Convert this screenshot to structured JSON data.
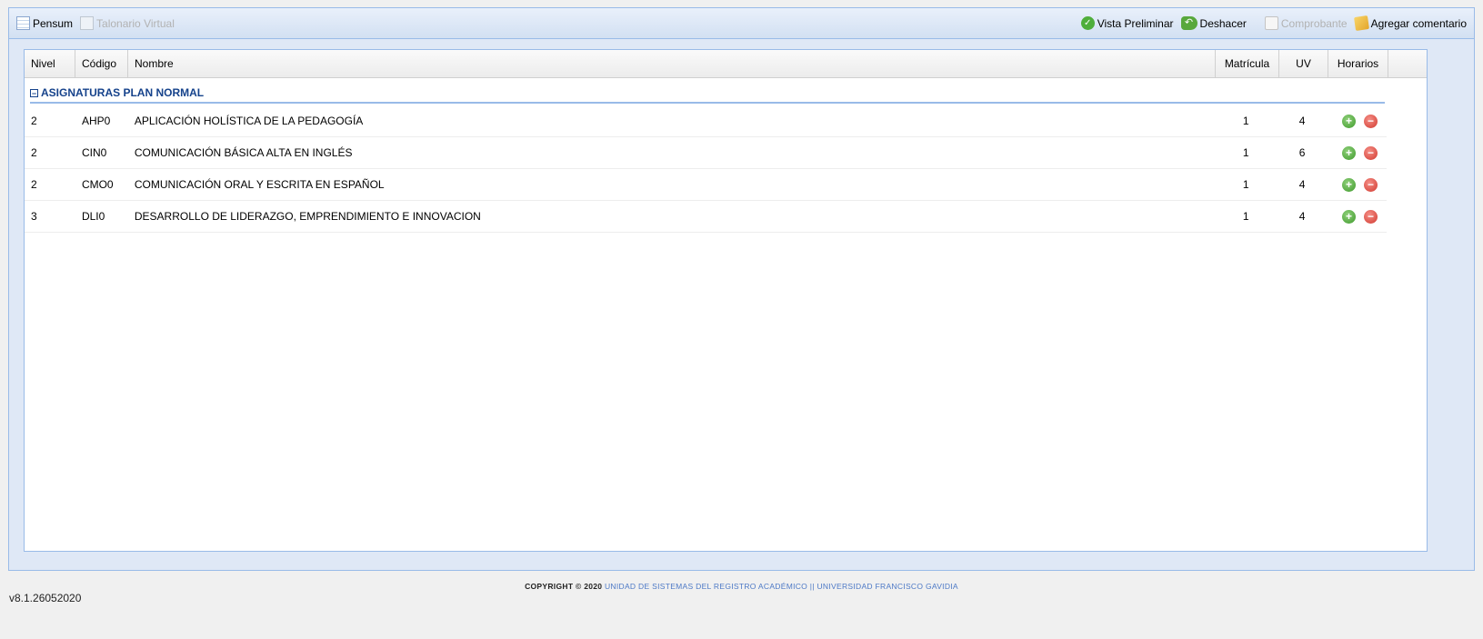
{
  "toolbar": {
    "pensum": "Pensum",
    "talonario": "Talonario Virtual",
    "vista": "Vista Preliminar",
    "deshacer": "Deshacer",
    "comprobante": "Comprobante",
    "agregar": "Agregar comentario"
  },
  "grid": {
    "columns": {
      "nivel": "Nivel",
      "codigo": "Código",
      "nombre": "Nombre",
      "matricula": "Matrícula",
      "uv": "UV",
      "horarios": "Horarios"
    },
    "group": "ASIGNATURAS PLAN NORMAL",
    "group_toggle": "−",
    "add_glyph": "+",
    "remove_glyph": "−",
    "rows": [
      {
        "nivel": "2",
        "codigo": "AHP0",
        "nombre": "APLICACIÓN HOLÍSTICA DE LA PEDAGOGÍA",
        "matricula": "1",
        "uv": "4"
      },
      {
        "nivel": "2",
        "codigo": "CIN0",
        "nombre": "COMUNICACIÓN BÁSICA ALTA EN INGLÉS",
        "matricula": "1",
        "uv": "6"
      },
      {
        "nivel": "2",
        "codigo": "CMO0",
        "nombre": "COMUNICACIÓN ORAL Y ESCRITA EN ESPAÑOL",
        "matricula": "1",
        "uv": "4"
      },
      {
        "nivel": "3",
        "codigo": "DLI0",
        "nombre": "DESARROLLO DE LIDERAZGO, EMPRENDIMIENTO E INNOVACION",
        "matricula": "1",
        "uv": "4"
      }
    ]
  },
  "footer": {
    "copyright": "COPYRIGHT © 2020",
    "unidad": "UNIDAD DE SISTEMAS DEL REGISTRO ACADÉMICO",
    "separator": "||",
    "universidad": "UNIVERSIDAD FRANCISCO GAVIDIA"
  },
  "version": "v8.1.26052020"
}
